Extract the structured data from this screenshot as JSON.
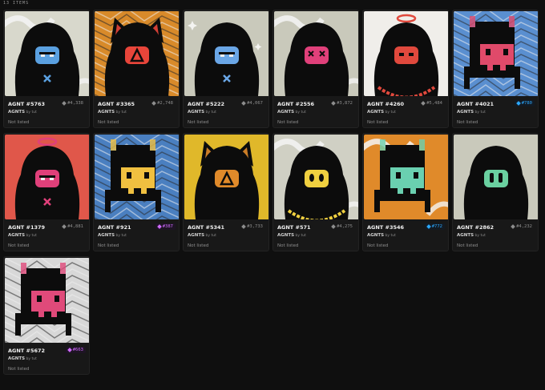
{
  "count_label": "13 ITEMS",
  "collection": {
    "name": "AGNTS",
    "by": "by tut"
  },
  "listing_status": "Not listed",
  "items": [
    {
      "name": "AGNT #5763",
      "rank": "#4,338",
      "rank_tier": "gray",
      "bg": "#d8d8cc",
      "accent": "#5aa0e0",
      "style": "hood",
      "pattern": "swirl"
    },
    {
      "name": "AGNT #3365",
      "rank": "#2,748",
      "rank_tier": "gray",
      "bg": "#d88a2a",
      "accent": "#e8453a",
      "style": "cat",
      "pattern": "scribble"
    },
    {
      "name": "AGNT #5222",
      "rank": "#4,067",
      "rank_tier": "gray",
      "bg": "#c9c9bb",
      "accent": "#6aa6e6",
      "style": "hood",
      "pattern": "sparkle"
    },
    {
      "name": "AGNT #2556",
      "rank": "#3,872",
      "rank_tier": "gray",
      "bg": "#c9c9bb",
      "accent": "#e0407a",
      "style": "hood",
      "pattern": "swirl"
    },
    {
      "name": "AGNT #4260",
      "rank": "#5,484",
      "rank_tier": "gray",
      "bg": "#f0eeea",
      "accent": "#e0493d",
      "style": "halo",
      "pattern": "plain"
    },
    {
      "name": "AGNT #4021",
      "rank": "#780",
      "rank_tier": "blue",
      "bg": "#5a8fd0",
      "accent": "#e04a6a",
      "style": "pixel",
      "pattern": "scribble"
    },
    {
      "name": "AGNT #1379",
      "rank": "#4,881",
      "rank_tier": "gray",
      "bg": "#e0574a",
      "accent": "#e0407a",
      "style": "halo-hood",
      "pattern": "plain"
    },
    {
      "name": "AGNT #921",
      "rank": "#387",
      "rank_tier": "purple",
      "bg": "#4a7fc0",
      "accent": "#f0c040",
      "style": "pixel",
      "pattern": "scribble"
    },
    {
      "name": "AGNT #5341",
      "rank": "#3,733",
      "rank_tier": "gray",
      "bg": "#e0b82a",
      "accent": "#e08a2a",
      "style": "cat",
      "pattern": "plain"
    },
    {
      "name": "AGNT #571",
      "rank": "#4,275",
      "rank_tier": "gray",
      "bg": "#d0d0c4",
      "accent": "#f0d040",
      "style": "hood",
      "pattern": "swirl"
    },
    {
      "name": "AGNT #3546",
      "rank": "#772",
      "rank_tier": "blue",
      "bg": "#e08a2a",
      "accent": "#6ad0b0",
      "style": "pixel",
      "pattern": "swirl"
    },
    {
      "name": "AGNT #2862",
      "rank": "#4,232",
      "rank_tier": "gray",
      "bg": "#c9c9bb",
      "accent": "#6ad0a0",
      "style": "hood",
      "pattern": "plain"
    },
    {
      "name": "AGNT #5672",
      "rank": "#663",
      "rank_tier": "purple",
      "bg": "#d8d8d8",
      "accent": "#e04a7a",
      "style": "pixel",
      "pattern": "scribble"
    }
  ]
}
